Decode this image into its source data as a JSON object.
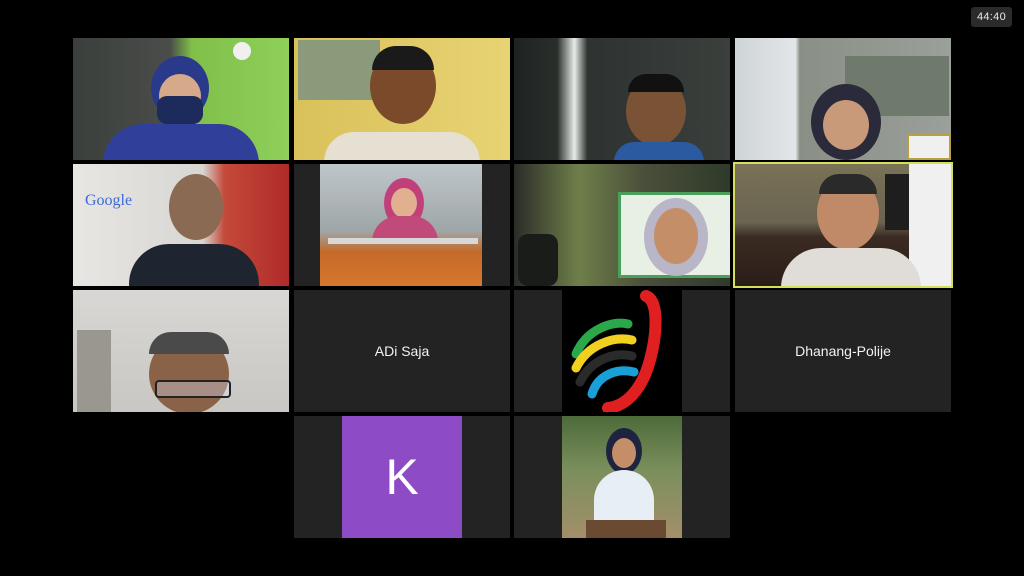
{
  "meeting": {
    "timer": "44:40"
  },
  "participants": {
    "adi": {
      "name": "ADi Saja"
    },
    "dhanang": {
      "name": "Dhanang-Polije"
    },
    "k": {
      "initial": "K"
    }
  },
  "video_text": {
    "google_sign": "Google"
  },
  "colors": {
    "active_speaker_border": "#d4e05a",
    "avatar_k": "#8e4bc6"
  }
}
